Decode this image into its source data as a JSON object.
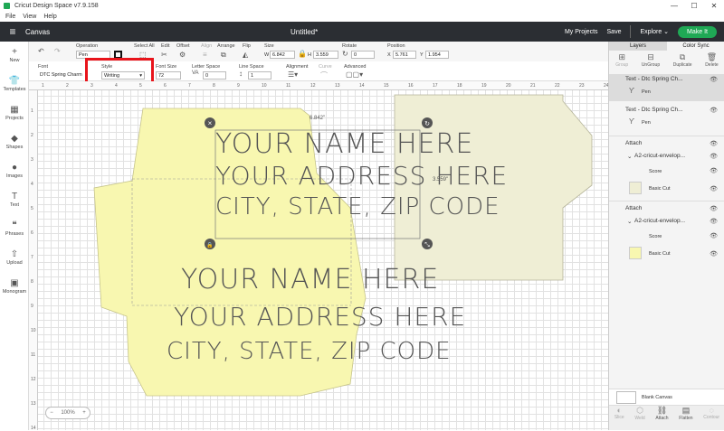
{
  "titlebar": {
    "title": "Cricut Design Space  v7.9.158",
    "minimize": "—",
    "maximize": "☐",
    "close": "✕"
  },
  "menu": [
    "File",
    "View",
    "Help"
  ],
  "header": {
    "menu_icon": "≡",
    "section": "Canvas",
    "doc_title": "Untitled*",
    "my_projects": "My Projects",
    "save": "Save",
    "machine": "Explore",
    "machine_caret": "⌄",
    "make_it": "Make It"
  },
  "toolbar1": {
    "operation_label": "Operation",
    "operation_value": "Pen",
    "select_all": "Select All",
    "edit": "Edit",
    "offset": "Offset",
    "align": "Align",
    "arrange": "Arrange",
    "flip": "Flip",
    "size_label": "Size",
    "w_label": "W",
    "w_value": "6.842",
    "h_label": "H",
    "h_value": "3.559",
    "rotate_label": "Rotate",
    "rotate_value": "0",
    "position_label": "Position",
    "x_label": "X",
    "x_value": "5.761",
    "y_label": "Y",
    "y_value": "1.954"
  },
  "toolbar2": {
    "font_label": "Font",
    "font_value": "DTC Spring Charm",
    "style_label": "Style",
    "style_value": "Writing",
    "font_size_label": "Font Size",
    "font_size_value": "72",
    "letter_space_label": "Letter Space",
    "letter_space_value": "0",
    "line_space_label": "Line Space",
    "line_space_value": "1",
    "alignment_label": "Alignment",
    "curve_label": "Curve",
    "advanced_label": "Advanced"
  },
  "leftbar": [
    {
      "label": "New",
      "icon": "+"
    },
    {
      "label": "Templates",
      "icon": "👕"
    },
    {
      "label": "Projects",
      "icon": "▦"
    },
    {
      "label": "Shapes",
      "icon": "◆"
    },
    {
      "label": "Images",
      "icon": "●"
    },
    {
      "label": "Text",
      "icon": "T"
    },
    {
      "label": "Phrases",
      "icon": "❝"
    },
    {
      "label": "Upload",
      "icon": "⇧"
    },
    {
      "label": "Monogram",
      "icon": "▣"
    }
  ],
  "ruler": {
    "top": [
      "1",
      "2",
      "3",
      "4",
      "5",
      "6",
      "7",
      "8",
      "9",
      "10",
      "11",
      "12",
      "13",
      "14",
      "15",
      "16",
      "17",
      "18",
      "19",
      "20",
      "21",
      "22",
      "23",
      "24"
    ],
    "left": [
      "1",
      "2",
      "3",
      "4",
      "5",
      "6",
      "7",
      "8",
      "9",
      "10",
      "11",
      "12",
      "13",
      "14"
    ]
  },
  "canvas": {
    "dim_width": "6.842\"",
    "dim_height": "3.559\"",
    "text_selected": [
      "YOUR NAME HERE",
      "YOUR ADDRESS HERE",
      "CITY, STATE, ZIP CODE"
    ],
    "text_envelope": [
      "YOUR NAME HERE",
      "YOUR ADDRESS HERE",
      "CITY, STATE, ZIP CODE"
    ],
    "zoom": "100%",
    "zoom_minus": "−",
    "zoom_plus": "+",
    "envelope_colors": {
      "yellow": "#f8f7b0",
      "cream": "#efeed5"
    }
  },
  "rpanel": {
    "tabs": [
      "Layers",
      "Color Sync"
    ],
    "tools": [
      {
        "label": "Group",
        "icon": "⊞"
      },
      {
        "label": "UnGroup",
        "icon": "⊟"
      },
      {
        "label": "Duplicate",
        "icon": "⧉"
      },
      {
        "label": "Delete",
        "icon": "🗑"
      }
    ],
    "layers": [
      {
        "title": "Text - Dtc Spring Ch...",
        "sub": "Pen"
      },
      {
        "title": "Text - Dtc Spring Ch...",
        "sub": "Pen"
      },
      {
        "title": "Attach",
        "group": "A2-cricut-envelop...",
        "items": [
          "Score",
          "Basic Cut"
        ]
      },
      {
        "title": "Attach",
        "group": "A2-cricut-envelop...",
        "items": [
          "Score",
          "Basic Cut"
        ]
      }
    ],
    "blank_canvas": "Blank Canvas",
    "bottom": [
      {
        "label": "Slice",
        "icon": "◐"
      },
      {
        "label": "Weld",
        "icon": "⬡"
      },
      {
        "label": "Attach",
        "icon": "⛓"
      },
      {
        "label": "Flatten",
        "icon": "▤"
      },
      {
        "label": "Contour",
        "icon": "◌"
      }
    ]
  }
}
